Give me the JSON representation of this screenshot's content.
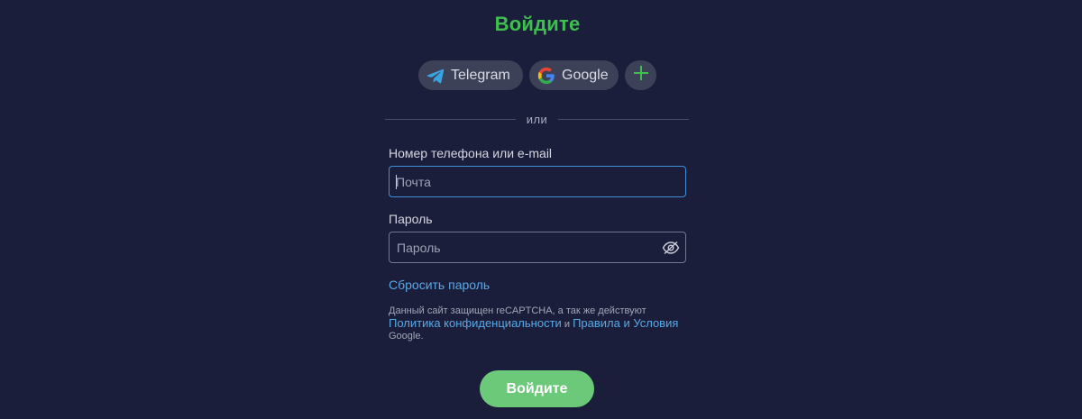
{
  "title": "Войдите",
  "social": {
    "telegram_label": "Telegram",
    "google_label": "Google",
    "more_label": "+"
  },
  "divider_text": "или",
  "form": {
    "email_label": "Номер телефона или e-mail",
    "email_value": "",
    "email_placeholder": "Почта",
    "password_label": "Пароль",
    "password_value": "",
    "password_placeholder": "Пароль"
  },
  "reset_password_link": "Сбросить пароль",
  "recaptcha": {
    "text_before": "Данный сайт защищен reCAPTCHA, а так же действуют ",
    "privacy_link": "Политика конфиденциальности",
    "and_text": " и ",
    "terms_link": "Правила и Условия",
    "text_after": " Google."
  },
  "submit_label": "Войдите",
  "colors": {
    "background": "#1b1e3a",
    "title_green": "#3fbf4f",
    "link_blue": "#5aa8e6",
    "submit_green": "#6dc97a",
    "focus_border": "#3f8fd8"
  },
  "icons": {
    "telegram": "telegram-icon",
    "google": "google-icon",
    "more": "plus-icon",
    "password_toggle": "eye-slash-icon"
  }
}
